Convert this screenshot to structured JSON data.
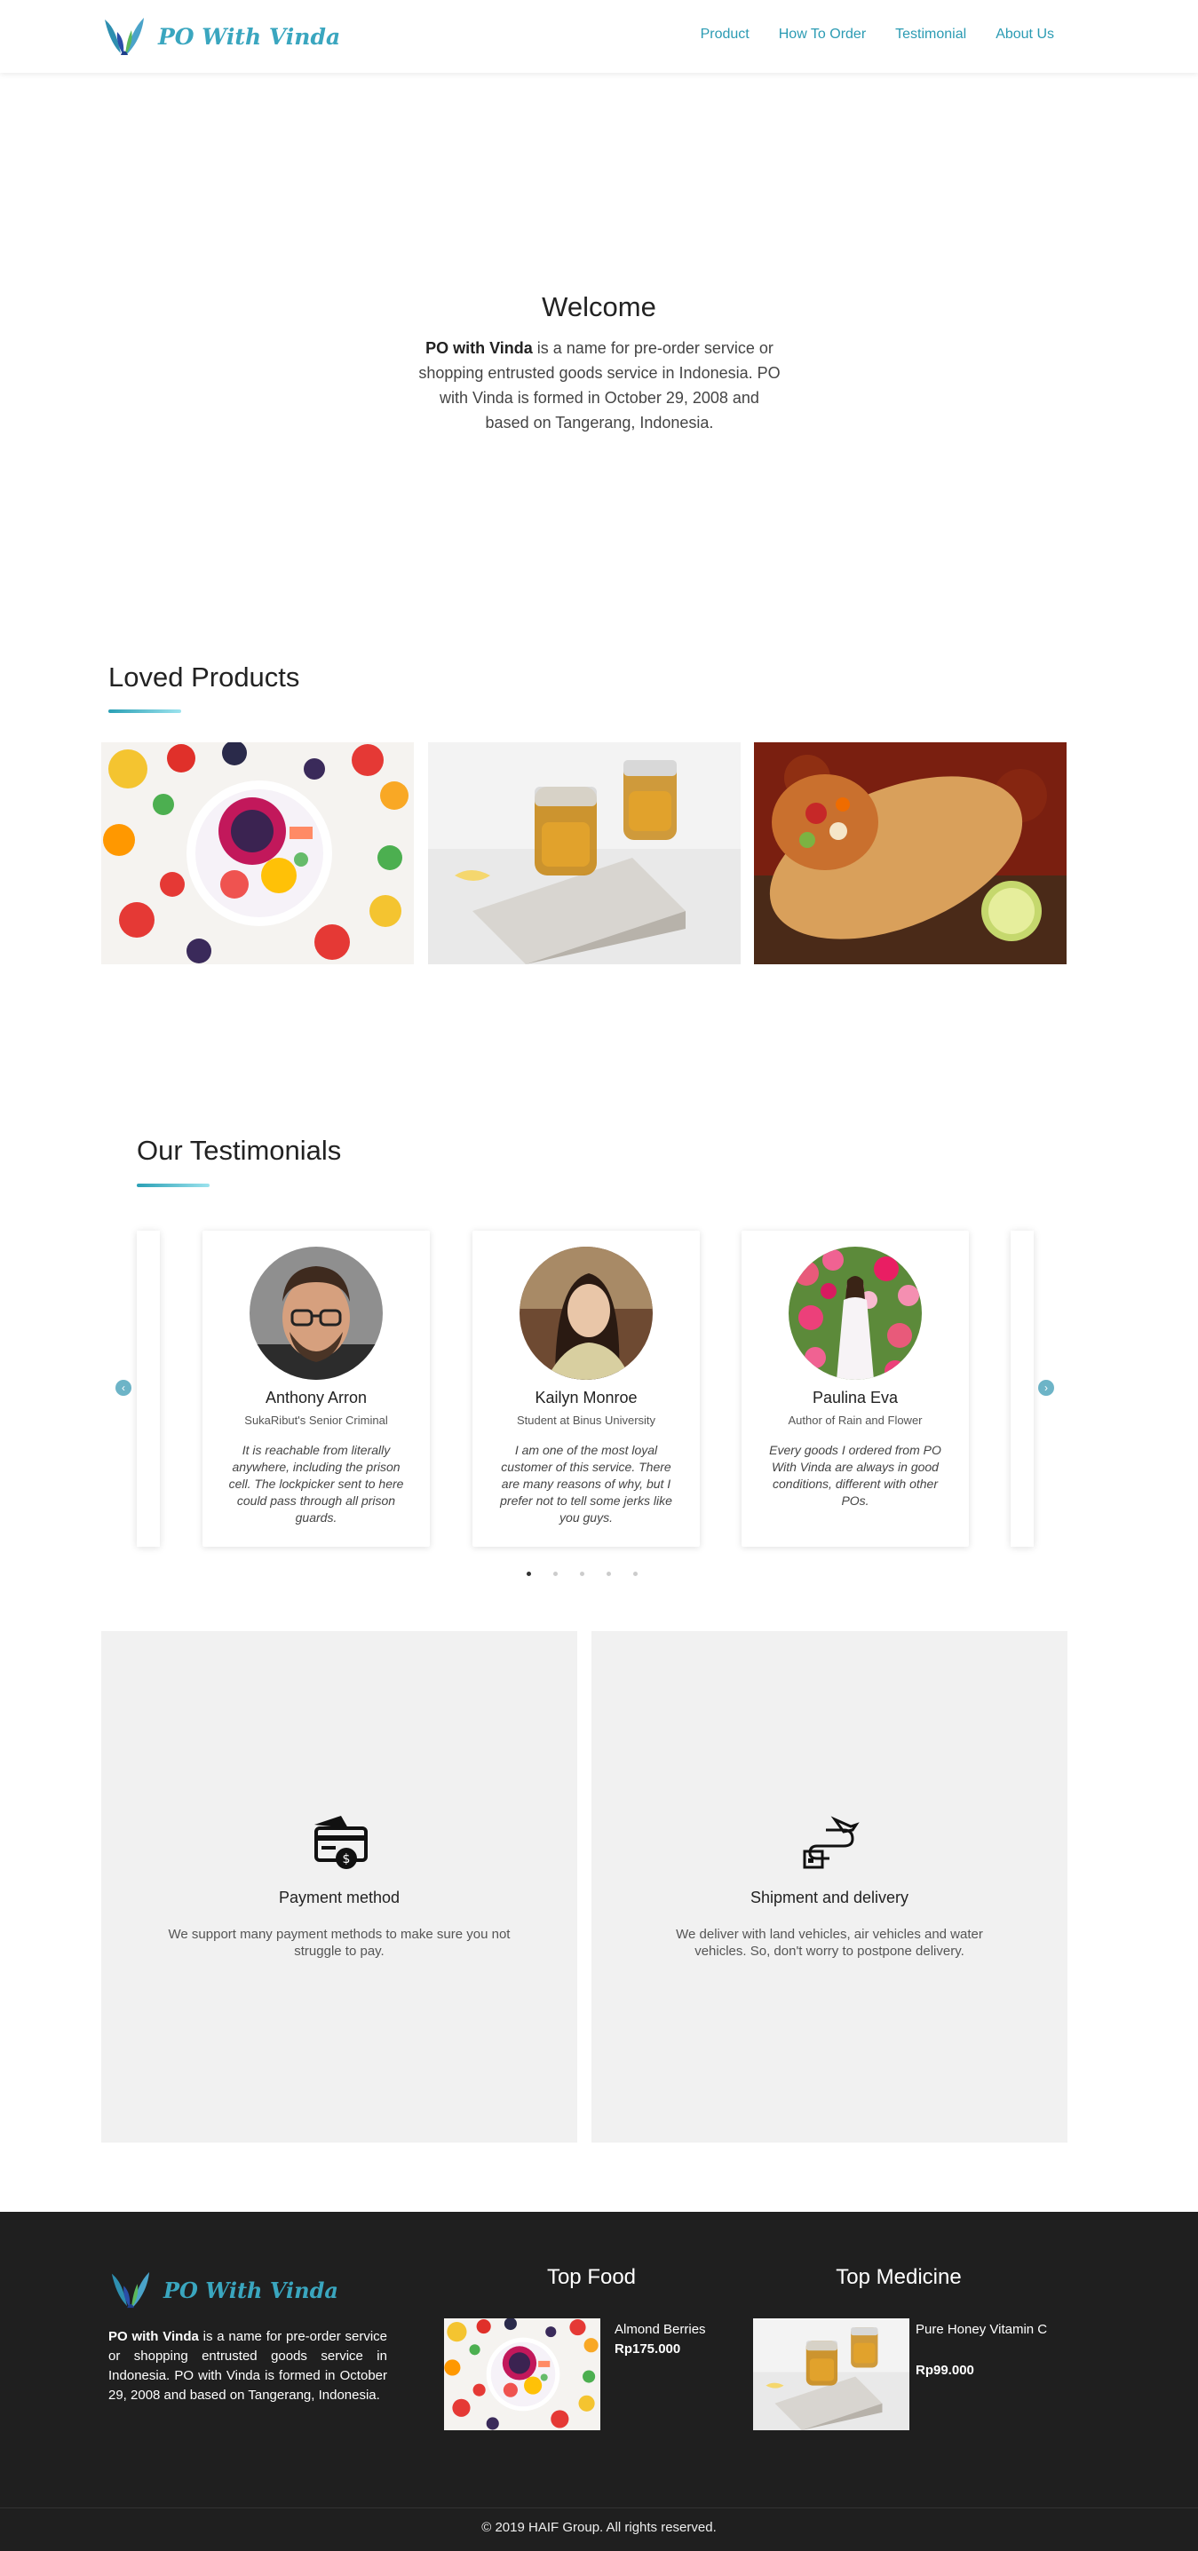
{
  "nav": {
    "brand": "PO With Vinda",
    "links": [
      "Product",
      "How To Order",
      "Testimonial",
      "About Us"
    ]
  },
  "hero": {
    "title": "Welcome",
    "brand_bold": "PO with Vinda",
    "text": " is a name for pre-order service or shopping entrusted goods service in Indonesia. PO with Vinda is formed in October 29, 2008 and based on Tangerang, Indonesia."
  },
  "products": {
    "title": "Loved Products",
    "items": [
      "fruit-bowl-image",
      "honey-jars-image",
      "burrito-image"
    ]
  },
  "testimonials": {
    "title": "Our Testimonials",
    "cards": [
      {
        "name": "Anthony Arron",
        "role": "SukaRibut's Senior Criminal",
        "quote": "It is reachable from literally anywhere, including the prison cell. The lockpicker sent to here could pass through all prison guards."
      },
      {
        "name": "Kailyn Monroe",
        "role": "Student at Binus University",
        "quote": "I am one of the most loyal customer of this service. There are many reasons of why, but I prefer not to tell some jerks like you guys."
      },
      {
        "name": "Paulina Eva",
        "role": "Author of Rain and Flower",
        "quote": "Every goods I ordered from PO With Vinda are always in good conditions, different with other POs."
      }
    ],
    "dots": 5,
    "active_dot": 0
  },
  "features": [
    {
      "icon": "payment-card-icon",
      "title": "Payment method",
      "text": "We support many payment methods to make sure you not struggle to pay."
    },
    {
      "icon": "shipment-route-icon",
      "title": "Shipment and delivery",
      "text": "We deliver with land vehicles, air vehicles and water vehicles. So, don't worry to postpone delivery."
    }
  ],
  "footer": {
    "brand": "PO With Vinda",
    "brand_bold": "PO with Vinda",
    "desc": " is a name for pre-order service or shopping entrusted goods service in Indonesia. PO with Vinda is formed in October 29, 2008 and based on Tangerang, Indonesia.",
    "top_food": {
      "title": "Top Food",
      "name": "Almond Berries",
      "price": "Rp175.000"
    },
    "top_medicine": {
      "title": "Top Medicine",
      "name": "Pure Honey Vitamin C",
      "price": "Rp99.000"
    },
    "copyright": "© 2019 HAIF Group. All rights reserved."
  },
  "colors": {
    "accent": "#2b9bb3",
    "footer_bg": "#1f1f1f",
    "feature_bg": "#f1f1f1"
  }
}
